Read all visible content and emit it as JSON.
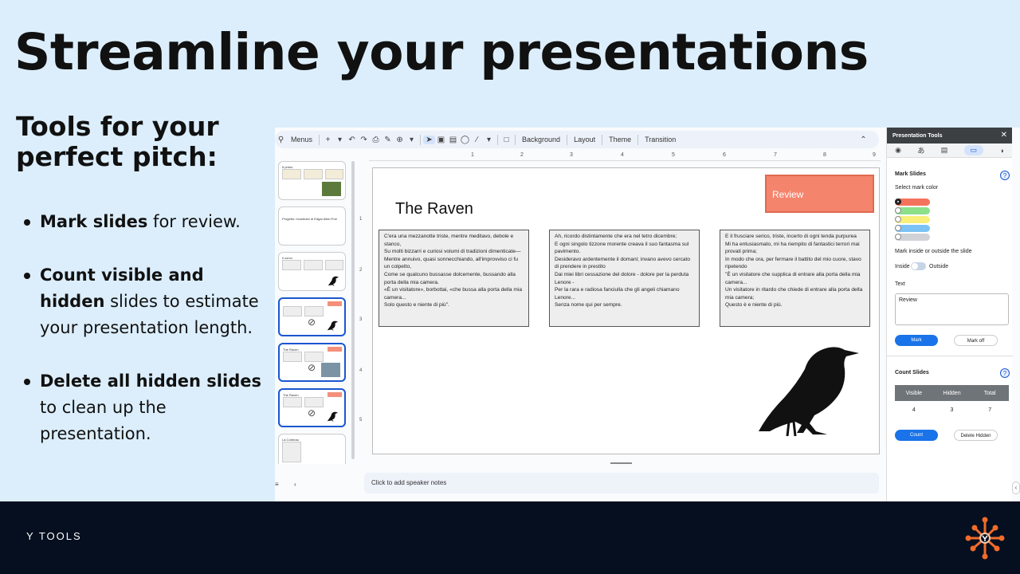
{
  "headline": "Streamline your presentations",
  "subhead": "Tools for your perfect pitch:",
  "bullets": [
    {
      "bold": "Mark slides",
      "rest": " for review."
    },
    {
      "bold": "Count visible and hidden",
      "rest": " slides to estimate your presentation length."
    },
    {
      "bold": "Delete all hidden slides",
      "rest": " to clean up the presentation."
    }
  ],
  "footer": {
    "brand": "Y TOOLS"
  },
  "app": {
    "toolbar": {
      "menus": "Menus",
      "background": "Background",
      "layout": "Layout",
      "theme": "Theme",
      "transition": "Transition"
    },
    "ruler_numbers": [
      "1",
      "2",
      "3",
      "4",
      "5",
      "6",
      "7",
      "8",
      "9"
    ],
    "vruler_numbers": [
      "1",
      "2",
      "3",
      "4",
      "5"
    ],
    "slide": {
      "title": "The Raven",
      "review_label": "Review",
      "stanzas": [
        "C'era una mezzanotte triste, mentre meditavo, debole e stanco,\nSu molti bizzarri e curiosi volumi di tradizioni dimenticate—\n    Mentre annuivo, quasi sonnecchiando, all'improvviso ci fu un colpetto,\nCome se qualcuno bussasse dolcemente, bussando alla porta della mia camera.\n«È un visitatore», borbottai, «che bussa alla porta della mia camera...\n            Solo questo e niente di più\".",
        "Ah, ricordo distintamente che era nel tetro dicembre;\nE ogni singolo tizzone morente creava il suo fantasma sul pavimento.\n    Desideravo ardentemente il domani; invano avevo cercato di prendere in prestito\n    Dai miei libri cessazione del dolore - dolore per la perduta Lenore -\nPer la rara e radiosa fanciulla che gli angeli chiamano Lenore...\n            Senza nome qui per sempre.",
        "E il frusciare serico, triste, incerto di ogni tenda purpurea\nMi ha entusiasmato, mi ha riempito di fantastici terrori mai provati prima;\n    In modo che ora, per fermare il battito del mio cuore, stavo ripetendo\n    \"È un visitatore che supplica di entrare alla porta della mia camera...\nUn visitatore in ritardo che chiede di entrare alla porta della mia camera;\n            Questo è e niente di più."
      ]
    },
    "notes_placeholder": "Click to add speaker notes",
    "panel": {
      "title": "Presentation Tools",
      "mark_section": "Mark Slides",
      "select_color": "Select mark color",
      "swatch_colors": [
        "#f4735c",
        "#8de08a",
        "#f9ef7a",
        "#7cc2f5",
        "#cfd3d8"
      ],
      "mark_position_label": "Mark inside or outside the slide",
      "inside": "Inside",
      "outside": "Outside",
      "text_label": "Text",
      "text_value": "Review",
      "mark_btn": "Mark",
      "mark_off_btn": "Mark off",
      "count_section": "Count Slides",
      "count_headers": [
        "Visible",
        "Hidden",
        "Total"
      ],
      "count_values": [
        "4",
        "3",
        "7"
      ],
      "count_btn": "Count",
      "delete_hidden_btn": "Delete Hidden"
    },
    "thumbnails": [
      {
        "title": "It primo"
      },
      {
        "title": "Progetto: ricostruire di Edgar Allan Poe"
      },
      {
        "title": "Il corvo"
      },
      {
        "title": "Il corvo"
      },
      {
        "title": "The Raven"
      },
      {
        "title": "The Raven"
      },
      {
        "title": "La Corbeau"
      }
    ]
  }
}
